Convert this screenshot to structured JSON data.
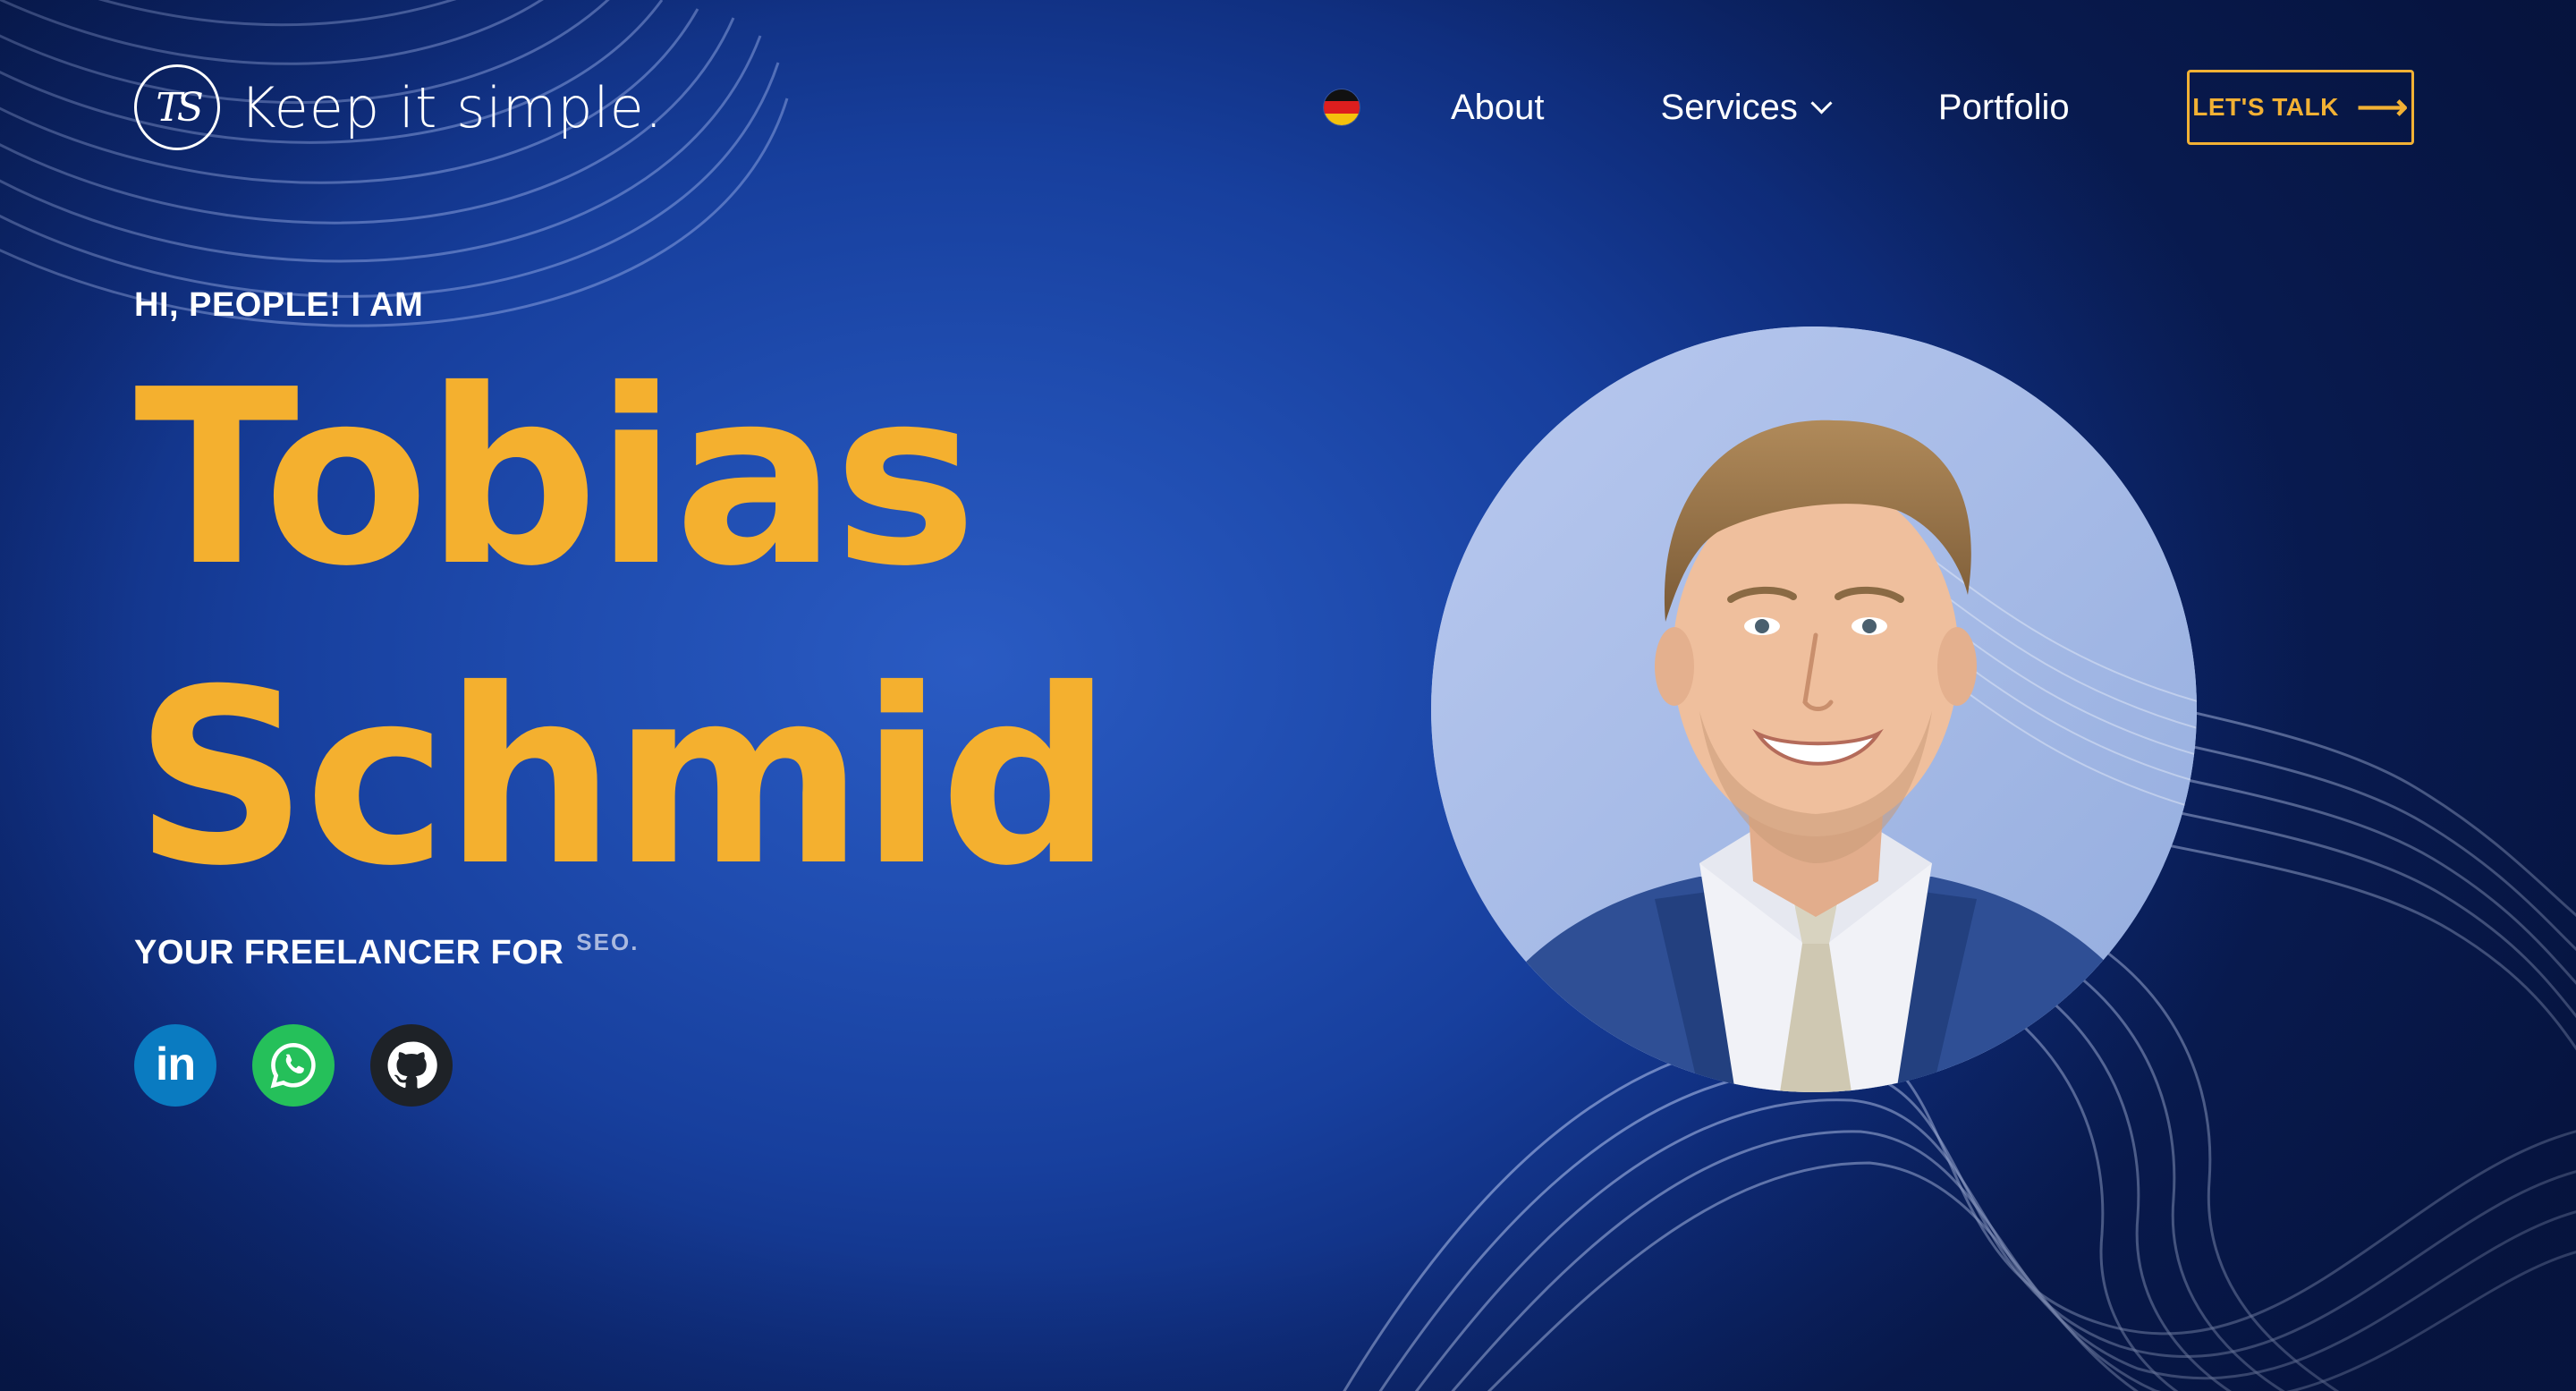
{
  "header": {
    "logo_text": "Keep it simple.",
    "logo_monogram": "TS",
    "language_flag": "german-flag-icon",
    "nav": {
      "about": "About",
      "services": "Services",
      "portfolio": "Portfolio"
    },
    "cta_label": "LET'S TALK",
    "cta_arrow": "⟶"
  },
  "hero": {
    "greeting": "HI, PEOPLE! I AM",
    "first_name": "Tobias",
    "last_name": "Schmid",
    "tagline_prefix": "YOUR FREELANCER FOR",
    "tagline_word": "SEO.",
    "socials": [
      {
        "name": "linkedin",
        "label": "in",
        "icon": "linkedin-icon"
      },
      {
        "name": "whatsapp",
        "icon": "whatsapp-icon"
      },
      {
        "name": "github",
        "icon": "github-icon"
      }
    ]
  },
  "colors": {
    "accent": "#f4b02f",
    "background": "#1f4caf",
    "text": "#ffffff"
  }
}
